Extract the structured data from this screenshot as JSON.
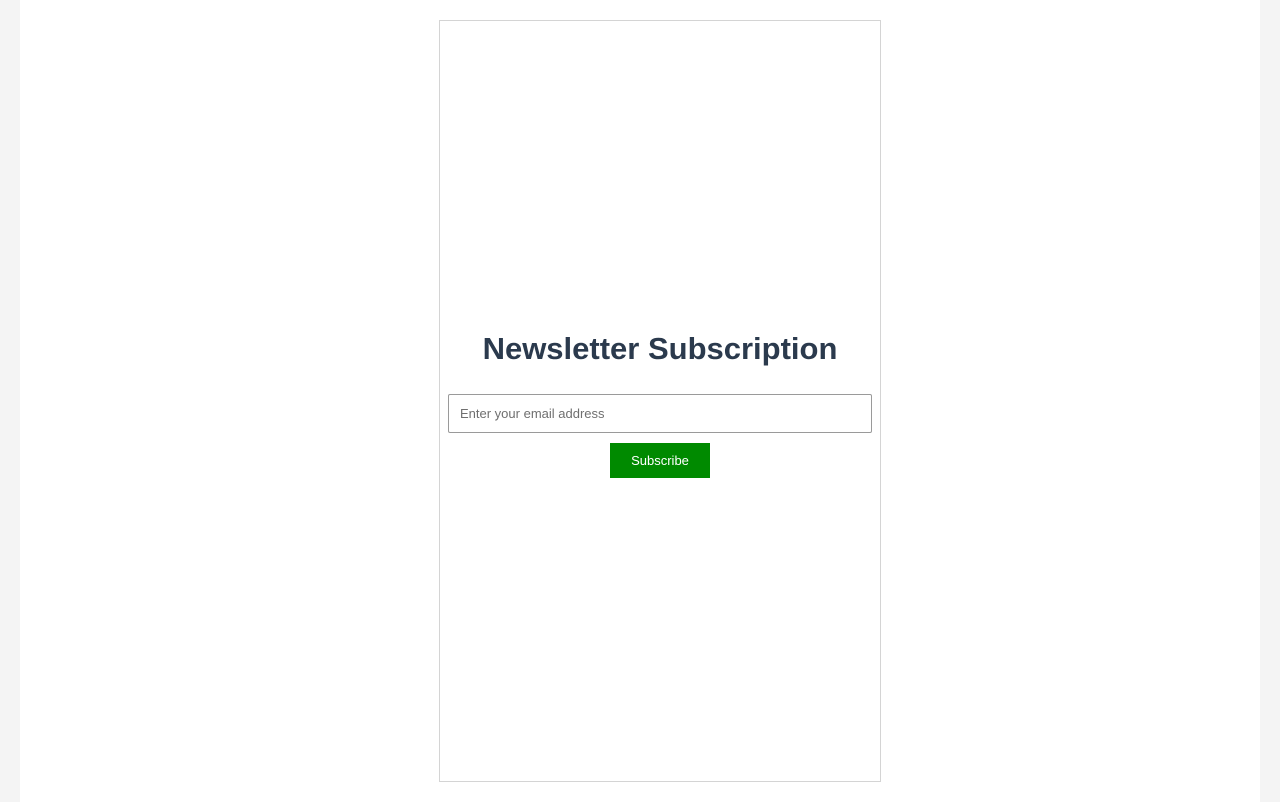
{
  "newsletter": {
    "title": "Newsletter Subscription",
    "email_placeholder": "Enter your email address",
    "email_value": "",
    "subscribe_label": "Subscribe"
  },
  "colors": {
    "page_background": "#f4f4f4",
    "content_background": "#ffffff",
    "title_color": "#2b3a4d",
    "button_background": "#008a00",
    "button_text": "#ffffff"
  }
}
